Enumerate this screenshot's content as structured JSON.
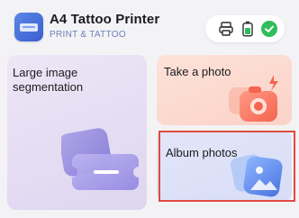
{
  "header": {
    "title": "A4 Tattoo Printer",
    "subtitle": "PRINT & TATTOO",
    "app_icon": "printer-app-icon",
    "status": {
      "printer_icon": "printer-icon",
      "battery_icon": "battery-icon",
      "connected_icon": "check-circle-icon",
      "connected_color": "#2fbe5a"
    }
  },
  "cards": {
    "large_segmentation": {
      "label": "Large image segmentation",
      "icon": "ticket-stack-icon"
    },
    "take_photo": {
      "label": "Take a photo",
      "icon": "camera-icon"
    },
    "album_photos": {
      "label": "Album photos",
      "icon": "gallery-icon"
    }
  },
  "colors": {
    "accent_blue": "#4a73e0",
    "photo_accent": "#f46a5a",
    "highlight_outline": "#e04a3f"
  }
}
